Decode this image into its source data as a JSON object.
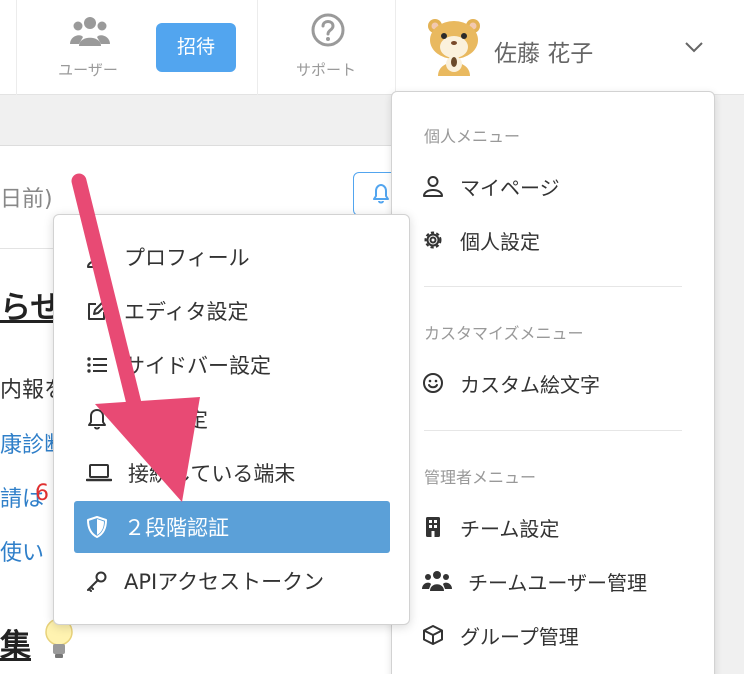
{
  "topbar": {
    "users_label": "ユーザー",
    "invite_label": "招待",
    "support_label": "サポート",
    "user_name": "佐藤 花子"
  },
  "background": {
    "date_fragment": "日前)",
    "heading_1": "らせ",
    "line_1": "内報を",
    "line_2": "康診断",
    "line_3a": "請は",
    "line_3b": "6",
    "line_4": "使い",
    "heading_2": "集"
  },
  "user_menu": {
    "personal_section": "個人メニュー",
    "mypage": "マイページ",
    "personal_settings": "個人設定",
    "customize_section": "カスタマイズメニュー",
    "custom_emoji": "カスタム絵文字",
    "admin_section": "管理者メニュー",
    "team_settings": "チーム設定",
    "team_user_management": "チームユーザー管理",
    "group_management": "グループ管理"
  },
  "settings_menu": {
    "items": [
      {
        "label": "プロフィール",
        "icon": "user-icon"
      },
      {
        "label": "エディタ設定",
        "icon": "edit-icon"
      },
      {
        "label": "サイドバー設定",
        "icon": "list-icon"
      },
      {
        "label": "通知設定",
        "icon": "bell-icon"
      },
      {
        "label": "接続している端末",
        "icon": "laptop-icon"
      },
      {
        "label": "２段階認証",
        "icon": "shield-icon"
      },
      {
        "label": "APIアクセストークン",
        "icon": "key-icon"
      }
    ],
    "active_index": 5
  },
  "colors": {
    "accent": "#52a5ef",
    "active_item": "#5ba0d8",
    "arrow": "#e84a74"
  }
}
